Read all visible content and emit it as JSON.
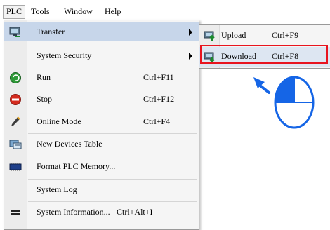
{
  "menubar": {
    "items": [
      {
        "label": "PLC",
        "active": true
      },
      {
        "label": "Tools"
      },
      {
        "label": "Window"
      },
      {
        "label": "Help"
      }
    ]
  },
  "plc_menu": {
    "items": [
      {
        "label": "Transfer",
        "icon": "transfer-icon",
        "submenu": true,
        "highlighted": true
      },
      {
        "label": "System Security",
        "submenu": true
      },
      {
        "label": "Run",
        "shortcut": "Ctrl+F11",
        "icon": "run-icon"
      },
      {
        "label": "Stop",
        "shortcut": "Ctrl+F12",
        "icon": "stop-icon"
      },
      {
        "label": "Online Mode",
        "shortcut": "Ctrl+F4",
        "icon": "online-mode-icon"
      },
      {
        "label": "New Devices Table",
        "icon": "devices-table-icon"
      },
      {
        "label": "Format PLC Memory...",
        "icon": "format-memory-icon"
      },
      {
        "label": "System Log"
      },
      {
        "label": "System Information...",
        "shortcut": "Ctrl+Alt+I",
        "icon": "system-info-icon"
      }
    ]
  },
  "transfer_submenu": {
    "items": [
      {
        "label": "Upload",
        "shortcut": "Ctrl+F9",
        "icon": "upload-icon"
      },
      {
        "label": "Download",
        "shortcut": "Ctrl+F8",
        "icon": "download-icon",
        "selected": true
      }
    ]
  },
  "annotation": {
    "highlight_color": "#e8141f",
    "pointer_color": "#1565e6",
    "icon": "mouse-icon"
  }
}
